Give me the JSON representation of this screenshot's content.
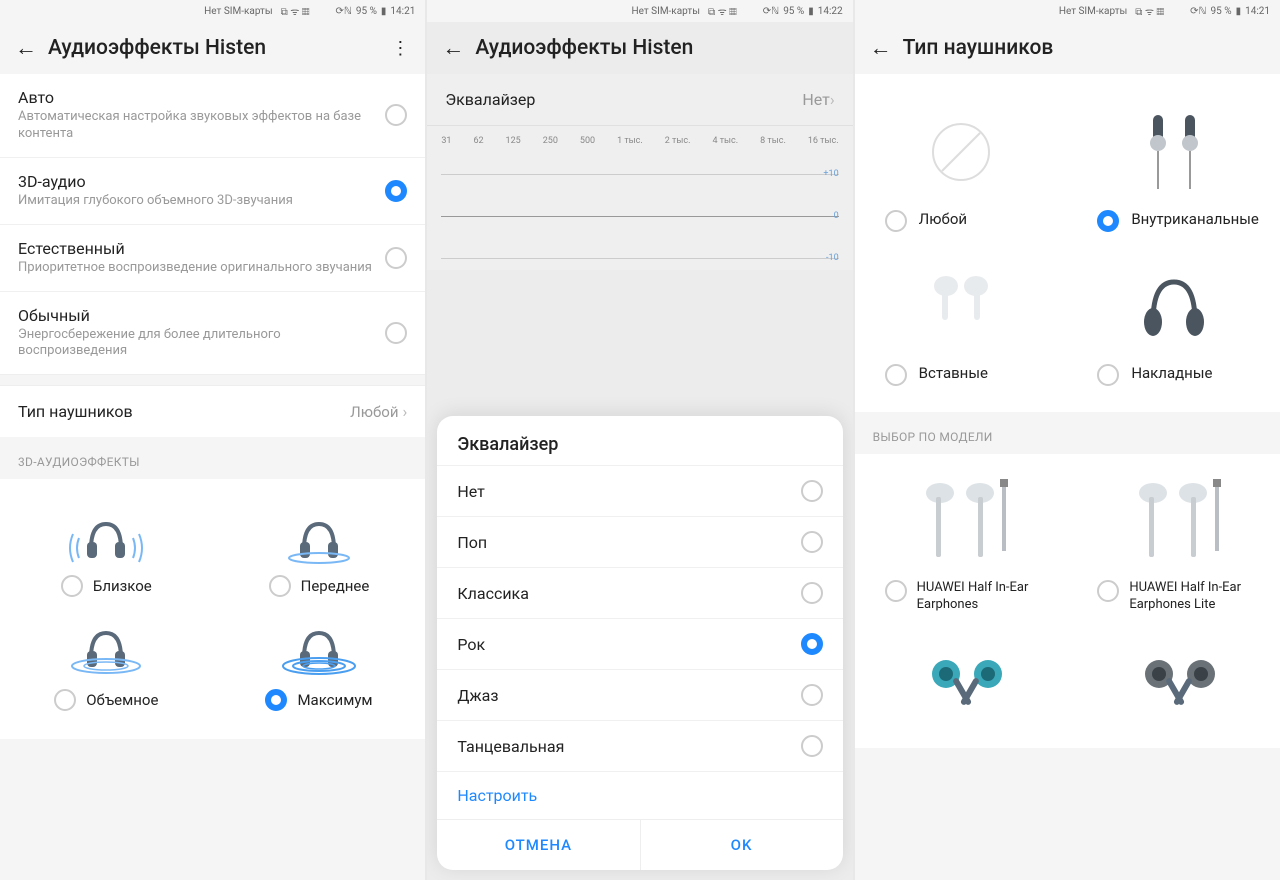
{
  "statusbar": {
    "sim": "Нет SIM-карты",
    "nfc": "N",
    "battery": "95 %"
  },
  "times": [
    "14:21",
    "14:22",
    "14:21"
  ],
  "p1": {
    "title": "Аудиоэффекты Histen",
    "opts": [
      {
        "t": "Авто",
        "s": "Автоматическая настройка звуковых эффектов на базе контента",
        "on": false
      },
      {
        "t": "3D-аудио",
        "s": "Имитация глубокого объемного 3D-звучания",
        "on": true
      },
      {
        "t": "Естественный",
        "s": "Приоритетное воспроизведение оригинального звучания",
        "on": false
      },
      {
        "t": "Обычный",
        "s": "Энергосбережение для более длительного воспроизведения",
        "on": false
      }
    ],
    "hp_label": "Тип наушников",
    "hp_value": "Любой",
    "sec3d": "3D-АУДИОЭФФЕКТЫ",
    "fx": [
      {
        "l": "Близкое",
        "on": false
      },
      {
        "l": "Переднее",
        "on": false
      },
      {
        "l": "Объемное",
        "on": false
      },
      {
        "l": "Максимум",
        "on": true
      }
    ]
  },
  "p2": {
    "title": "Аудиоэффекты Histen",
    "eq_label": "Эквалайзер",
    "eq_value": "Нет",
    "freqs": [
      "31",
      "62",
      "125",
      "250",
      "500",
      "1 тыс.",
      "2 тыс.",
      "4 тыс.",
      "8 тыс.",
      "16 тыс."
    ],
    "scale": [
      "+10",
      "0",
      "-10"
    ],
    "sheet_title": "Эквалайзер",
    "sheet_opts": [
      {
        "l": "Нет",
        "on": false
      },
      {
        "l": "Поп",
        "on": false
      },
      {
        "l": "Классика",
        "on": false
      },
      {
        "l": "Рок",
        "on": true
      },
      {
        "l": "Джаз",
        "on": false
      },
      {
        "l": "Танцевальная",
        "on": false
      }
    ],
    "customize": "Настроить",
    "cancel": "ОТМЕНА",
    "ok": "OK"
  },
  "p3": {
    "title": "Тип наушников",
    "types": [
      {
        "l": "Любой",
        "on": false
      },
      {
        "l": "Внутриканальные",
        "on": true
      },
      {
        "l": "Вставные",
        "on": false
      },
      {
        "l": "Накладные",
        "on": false
      }
    ],
    "model_sec": "ВЫБОР ПО МОДЕЛИ",
    "models": [
      {
        "l": "HUAWEI Half In-Ear Earphones",
        "on": false
      },
      {
        "l": "HUAWEI Half In-Ear Earphones Lite",
        "on": false
      }
    ]
  }
}
